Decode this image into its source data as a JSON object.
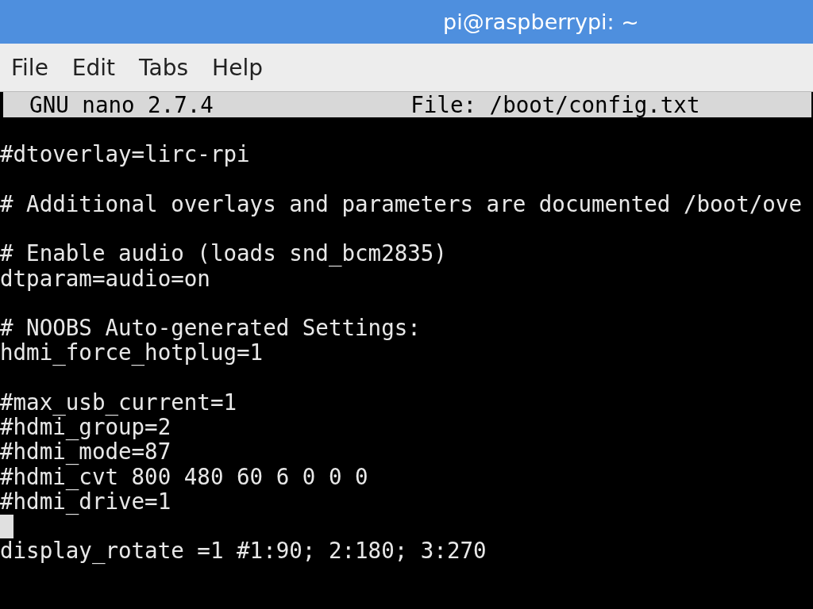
{
  "window": {
    "title": "pi@raspberrypi: ~"
  },
  "menu": [
    "File",
    "Edit",
    "Tabs",
    "Help"
  ],
  "editor_header": {
    "app": "GNU nano 2.7.4",
    "file": "File: /boot/config.txt"
  },
  "lines": [
    {
      "kind": "blank"
    },
    {
      "kind": "text",
      "text": "#dtoverlay=lirc-rpi"
    },
    {
      "kind": "blank"
    },
    {
      "kind": "text",
      "text": "# Additional overlays and parameters are documented /boot/ove"
    },
    {
      "kind": "blank"
    },
    {
      "kind": "text",
      "text": "# Enable audio (loads snd_bcm2835)"
    },
    {
      "kind": "text",
      "text": "dtparam=audio=on"
    },
    {
      "kind": "blank"
    },
    {
      "kind": "text",
      "text": "# NOOBS Auto-generated Settings:"
    },
    {
      "kind": "text",
      "text": "hdmi_force_hotplug=1"
    },
    {
      "kind": "blank"
    },
    {
      "kind": "text",
      "text": "#max_usb_current=1"
    },
    {
      "kind": "text",
      "text": "#hdmi_group=2"
    },
    {
      "kind": "text",
      "text": "#hdmi_mode=87"
    },
    {
      "kind": "text",
      "text": "#hdmi_cvt 800 480 60 6 0 0 0"
    },
    {
      "kind": "text",
      "text": "#hdmi_drive=1"
    },
    {
      "kind": "cursor"
    },
    {
      "kind": "text",
      "text": "display_rotate =1 #1:90; 2:180; 3:270"
    }
  ]
}
